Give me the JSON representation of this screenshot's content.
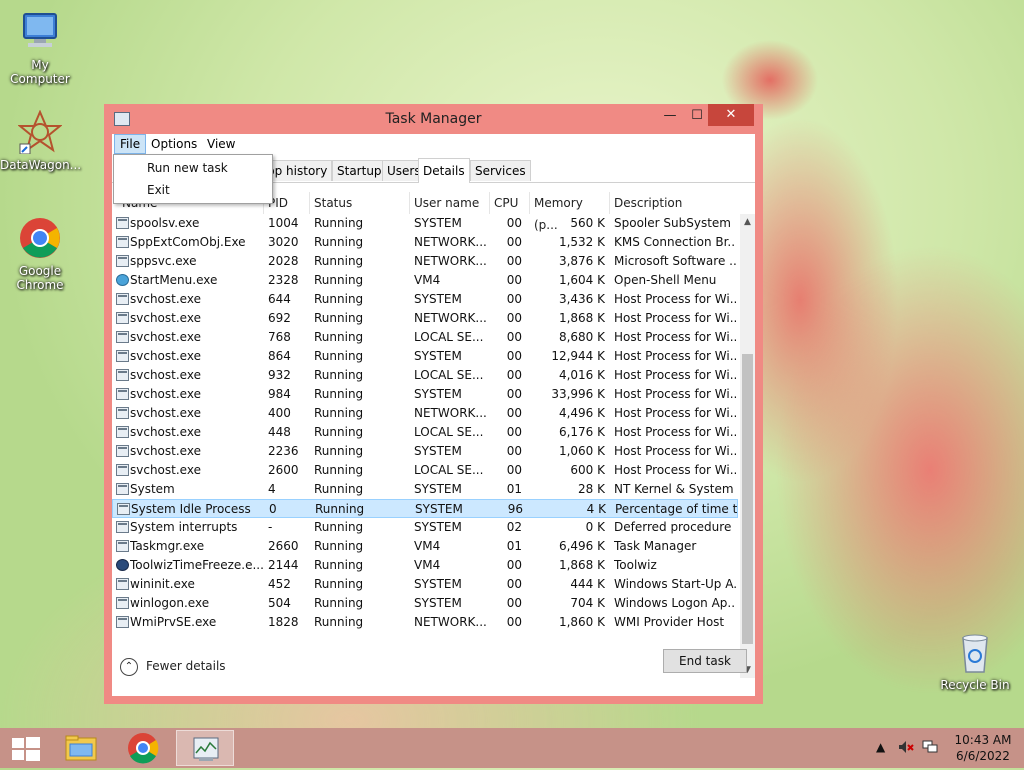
{
  "desktop": {
    "icons": [
      {
        "label": "My Computer"
      },
      {
        "label": "DataWagon..."
      },
      {
        "label": "Google Chrome"
      },
      {
        "label": "Recycle Bin"
      }
    ]
  },
  "window": {
    "title": "Task Manager",
    "buttons": {
      "minimize": "—",
      "maximize": "☐",
      "close": "✕"
    },
    "menu": [
      "File",
      "Options",
      "View"
    ],
    "file_menu": {
      "items": [
        "Run new task",
        "Exit"
      ]
    },
    "tabs": [
      "pp history",
      "Startup",
      "Users",
      "Details",
      "Services"
    ],
    "selected_tab": "Details",
    "columns": [
      "Name",
      "PID",
      "Status",
      "User name",
      "CPU",
      "Memory (p...",
      "Description"
    ],
    "rows": [
      {
        "name": "spoolsv.exe",
        "pid": "1004",
        "status": "Running",
        "user": "SYSTEM",
        "cpu": "00",
        "mem": "560 K",
        "desc": "Spooler SubSystem ..."
      },
      {
        "name": "SppExtComObj.Exe",
        "pid": "3020",
        "status": "Running",
        "user": "NETWORK...",
        "cpu": "00",
        "mem": "1,532 K",
        "desc": "KMS Connection Br..."
      },
      {
        "name": "sppsvc.exe",
        "pid": "2028",
        "status": "Running",
        "user": "NETWORK...",
        "cpu": "00",
        "mem": "3,876 K",
        "desc": "Microsoft Software ..."
      },
      {
        "name": "StartMenu.exe",
        "pid": "2328",
        "status": "Running",
        "user": "VM4",
        "cpu": "00",
        "mem": "1,604 K",
        "desc": "Open-Shell Menu"
      },
      {
        "name": "svchost.exe",
        "pid": "644",
        "status": "Running",
        "user": "SYSTEM",
        "cpu": "00",
        "mem": "3,436 K",
        "desc": "Host Process for Wi..."
      },
      {
        "name": "svchost.exe",
        "pid": "692",
        "status": "Running",
        "user": "NETWORK...",
        "cpu": "00",
        "mem": "1,868 K",
        "desc": "Host Process for Wi..."
      },
      {
        "name": "svchost.exe",
        "pid": "768",
        "status": "Running",
        "user": "LOCAL SE...",
        "cpu": "00",
        "mem": "8,680 K",
        "desc": "Host Process for Wi..."
      },
      {
        "name": "svchost.exe",
        "pid": "864",
        "status": "Running",
        "user": "SYSTEM",
        "cpu": "00",
        "mem": "12,944 K",
        "desc": "Host Process for Wi..."
      },
      {
        "name": "svchost.exe",
        "pid": "932",
        "status": "Running",
        "user": "LOCAL SE...",
        "cpu": "00",
        "mem": "4,016 K",
        "desc": "Host Process for Wi..."
      },
      {
        "name": "svchost.exe",
        "pid": "984",
        "status": "Running",
        "user": "SYSTEM",
        "cpu": "00",
        "mem": "33,996 K",
        "desc": "Host Process for Wi..."
      },
      {
        "name": "svchost.exe",
        "pid": "400",
        "status": "Running",
        "user": "NETWORK...",
        "cpu": "00",
        "mem": "4,496 K",
        "desc": "Host Process for Wi..."
      },
      {
        "name": "svchost.exe",
        "pid": "448",
        "status": "Running",
        "user": "LOCAL SE...",
        "cpu": "00",
        "mem": "6,176 K",
        "desc": "Host Process for Wi..."
      },
      {
        "name": "svchost.exe",
        "pid": "2236",
        "status": "Running",
        "user": "SYSTEM",
        "cpu": "00",
        "mem": "1,060 K",
        "desc": "Host Process for Wi..."
      },
      {
        "name": "svchost.exe",
        "pid": "2600",
        "status": "Running",
        "user": "LOCAL SE...",
        "cpu": "00",
        "mem": "600 K",
        "desc": "Host Process for Wi..."
      },
      {
        "name": "System",
        "pid": "4",
        "status": "Running",
        "user": "SYSTEM",
        "cpu": "01",
        "mem": "28 K",
        "desc": "NT Kernel & System"
      },
      {
        "name": "System Idle Process",
        "pid": "0",
        "status": "Running",
        "user": "SYSTEM",
        "cpu": "96",
        "mem": "4 K",
        "desc": "Percentage of time t...",
        "selected": true
      },
      {
        "name": "System interrupts",
        "pid": "-",
        "status": "Running",
        "user": "SYSTEM",
        "cpu": "02",
        "mem": "0 K",
        "desc": "Deferred procedure ..."
      },
      {
        "name": "Taskmgr.exe",
        "pid": "2660",
        "status": "Running",
        "user": "VM4",
        "cpu": "01",
        "mem": "6,496 K",
        "desc": "Task Manager"
      },
      {
        "name": "ToolwizTimeFreeze.e...",
        "pid": "2144",
        "status": "Running",
        "user": "VM4",
        "cpu": "00",
        "mem": "1,868 K",
        "desc": "Toolwiz"
      },
      {
        "name": "wininit.exe",
        "pid": "452",
        "status": "Running",
        "user": "SYSTEM",
        "cpu": "00",
        "mem": "444 K",
        "desc": "Windows Start-Up A..."
      },
      {
        "name": "winlogon.exe",
        "pid": "504",
        "status": "Running",
        "user": "SYSTEM",
        "cpu": "00",
        "mem": "704 K",
        "desc": "Windows Logon Ap..."
      },
      {
        "name": "WmiPrvSE.exe",
        "pid": "1828",
        "status": "Running",
        "user": "NETWORK...",
        "cpu": "00",
        "mem": "1,860 K",
        "desc": "WMI Provider Host"
      }
    ],
    "fewer_details": "Fewer details",
    "end_task": "End task"
  },
  "taskbar": {
    "time": "10:43 AM",
    "date": "6/6/2022"
  },
  "colors": {
    "window_frame": "#f08a84",
    "close_button": "#c7463c",
    "taskbar": "#c69288",
    "selection": "#cce8ff"
  }
}
